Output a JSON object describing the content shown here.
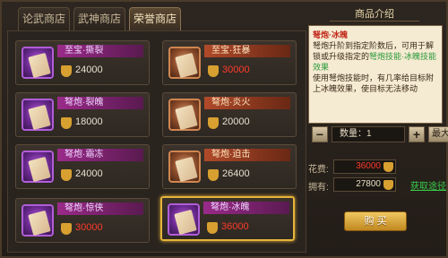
{
  "tabs": [
    {
      "label": "论武商店",
      "active": false
    },
    {
      "label": "武神商店",
      "active": false
    },
    {
      "label": "荣誉商店",
      "active": true
    }
  ],
  "items": [
    {
      "name": "至宝·撕裂",
      "price": "24000",
      "price_red": false,
      "rarity": "purple"
    },
    {
      "name": "至宝·狂暴",
      "price": "30000",
      "price_red": true,
      "rarity": "gold"
    },
    {
      "name": "弩炮·裂魄",
      "price": "18000",
      "price_red": false,
      "rarity": "purple"
    },
    {
      "name": "弩炮·炎火",
      "price": "20000",
      "price_red": false,
      "rarity": "gold"
    },
    {
      "name": "弩炮·霜冻",
      "price": "24000",
      "price_red": false,
      "rarity": "purple"
    },
    {
      "name": "弩炮·迫击",
      "price": "26400",
      "price_red": false,
      "rarity": "gold"
    },
    {
      "name": "弩炮·惊侠",
      "price": "30000",
      "price_red": true,
      "rarity": "purple"
    },
    {
      "name": "弩炮·冰魄",
      "price": "36000",
      "price_red": true,
      "rarity": "purple",
      "selected": true
    }
  ],
  "detail": {
    "header": "商品介绍",
    "title": "弩炮·冰魄",
    "line1": "弩炮升阶到指定阶数后，可用于解锁或升级指定的",
    "line1_hl": "弩炮技能·冰魄技能效果",
    "line2": "使用弩炮技能时，有几率给目标附上冰魄效果，使目标无法移动"
  },
  "quantity": {
    "label": "数量：",
    "value": "1",
    "minus": "−",
    "plus": "+",
    "max": "最大"
  },
  "cost": {
    "label": "花费:",
    "value": "36000"
  },
  "owned": {
    "label": "拥有:",
    "value": "27800"
  },
  "get_link": "获取途径",
  "buy_label": "购 买",
  "colors": {
    "accent": "#e6b43a",
    "red": "#ff3a2a",
    "green": "#3acc4a"
  }
}
